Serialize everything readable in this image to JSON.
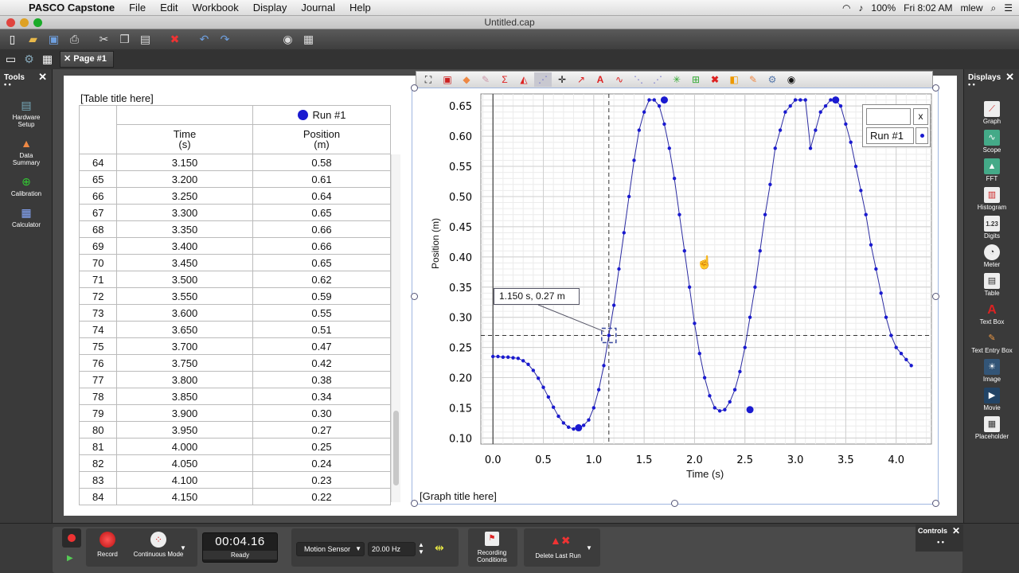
{
  "menubar": {
    "app_name": "PASCO Capstone",
    "items": [
      "File",
      "Edit",
      "Workbook",
      "Display",
      "Journal",
      "Help"
    ],
    "battery": "100%",
    "clock": "Fri 8:02 AM",
    "user": "mlew"
  },
  "window": {
    "title": "Untitled.cap"
  },
  "tabs": {
    "page_label": "Page #1"
  },
  "tools_panel": {
    "title": "Tools",
    "items": [
      {
        "label1": "Hardware",
        "label2": "Setup"
      },
      {
        "label1": "Data",
        "label2": "Summary"
      },
      {
        "label1": "Calibration",
        "label2": ""
      },
      {
        "label1": "Calculator",
        "label2": ""
      }
    ]
  },
  "displays_panel": {
    "title": "Displays",
    "items": [
      "Graph",
      "Scope",
      "FFT",
      "Histogram",
      "Digits",
      "Meter",
      "Table",
      "Text Box",
      "Text Entry Box",
      "Image",
      "Movie",
      "Placeholder"
    ],
    "digits_icon_text": "1.23"
  },
  "table": {
    "title": "[Table title here]",
    "run_label": "Run #1",
    "run_color": "#1a1ad0",
    "col_time": "Time",
    "col_time_unit": "(s)",
    "col_pos": "Position",
    "col_pos_unit": "(m)",
    "rows": [
      [
        "64",
        "3.150",
        "0.58"
      ],
      [
        "65",
        "3.200",
        "0.61"
      ],
      [
        "66",
        "3.250",
        "0.64"
      ],
      [
        "67",
        "3.300",
        "0.65"
      ],
      [
        "68",
        "3.350",
        "0.66"
      ],
      [
        "69",
        "3.400",
        "0.66"
      ],
      [
        "70",
        "3.450",
        "0.65"
      ],
      [
        "71",
        "3.500",
        "0.62"
      ],
      [
        "72",
        "3.550",
        "0.59"
      ],
      [
        "73",
        "3.600",
        "0.55"
      ],
      [
        "74",
        "3.650",
        "0.51"
      ],
      [
        "75",
        "3.700",
        "0.47"
      ],
      [
        "76",
        "3.750",
        "0.42"
      ],
      [
        "77",
        "3.800",
        "0.38"
      ],
      [
        "78",
        "3.850",
        "0.34"
      ],
      [
        "79",
        "3.900",
        "0.30"
      ],
      [
        "80",
        "3.950",
        "0.27"
      ],
      [
        "81",
        "4.000",
        "0.25"
      ],
      [
        "82",
        "4.050",
        "0.24"
      ],
      [
        "83",
        "4.100",
        "0.23"
      ],
      [
        "84",
        "4.150",
        "0.22"
      ]
    ]
  },
  "graph": {
    "title": "[Graph title here]",
    "callout": "1.150 s, 0.27 m",
    "legend_run": "Run #1",
    "legend_close": "x"
  },
  "chart_data": {
    "type": "line",
    "xlabel": "Time (s)",
    "ylabel": "Position (m)",
    "xlim": [
      -0.12,
      4.35
    ],
    "ylim": [
      0.09,
      0.67
    ],
    "xticks": [
      0.0,
      0.5,
      1.0,
      1.5,
      2.0,
      2.5,
      3.0,
      3.5,
      4.0
    ],
    "yticks": [
      0.1,
      0.15,
      0.2,
      0.25,
      0.3,
      0.35,
      0.4,
      0.45,
      0.5,
      0.55,
      0.6,
      0.65
    ],
    "grid": true,
    "legend_position": "top-right",
    "series": [
      {
        "name": "Run #1",
        "color": "#1a1ad0",
        "x": [
          0.0,
          0.05,
          0.1,
          0.15,
          0.2,
          0.25,
          0.3,
          0.35,
          0.4,
          0.45,
          0.5,
          0.55,
          0.6,
          0.65,
          0.7,
          0.75,
          0.8,
          0.85,
          0.9,
          0.95,
          1.0,
          1.05,
          1.1,
          1.15,
          1.2,
          1.25,
          1.3,
          1.35,
          1.4,
          1.45,
          1.5,
          1.55,
          1.6,
          1.65,
          1.7,
          1.75,
          1.8,
          1.85,
          1.9,
          1.95,
          2.0,
          2.05,
          2.1,
          2.15,
          2.2,
          2.25,
          2.3,
          2.35,
          2.4,
          2.45,
          2.5,
          2.55,
          2.6,
          2.65,
          2.7,
          2.75,
          2.8,
          2.85,
          2.9,
          2.95,
          3.0,
          3.05,
          3.1,
          3.15,
          3.2,
          3.25,
          3.3,
          3.35,
          3.4,
          3.45,
          3.5,
          3.55,
          3.6,
          3.65,
          3.7,
          3.75,
          3.8,
          3.85,
          3.9,
          3.95,
          4.0,
          4.05,
          4.1,
          4.15
        ],
        "y": [
          0.235,
          0.235,
          0.234,
          0.234,
          0.233,
          0.232,
          0.228,
          0.222,
          0.212,
          0.199,
          0.184,
          0.168,
          0.151,
          0.136,
          0.125,
          0.118,
          0.115,
          0.117,
          0.121,
          0.13,
          0.15,
          0.18,
          0.22,
          0.27,
          0.32,
          0.38,
          0.44,
          0.5,
          0.56,
          0.61,
          0.64,
          0.66,
          0.66,
          0.65,
          0.62,
          0.58,
          0.53,
          0.47,
          0.41,
          0.35,
          0.29,
          0.24,
          0.2,
          0.17,
          0.15,
          0.145,
          0.147,
          0.16,
          0.18,
          0.21,
          0.25,
          0.3,
          0.35,
          0.41,
          0.47,
          0.52,
          0.58,
          0.61,
          0.64,
          0.65,
          0.66,
          0.66,
          0.66,
          0.58,
          0.61,
          0.64,
          0.65,
          0.66,
          0.66,
          0.65,
          0.62,
          0.59,
          0.55,
          0.51,
          0.47,
          0.42,
          0.38,
          0.34,
          0.3,
          0.27,
          0.25,
          0.24,
          0.23,
          0.22
        ],
        "markers_large": [
          [
            0.85,
            0.117
          ],
          [
            1.7,
            0.66
          ],
          [
            2.55,
            0.147
          ],
          [
            3.4,
            0.66
          ]
        ]
      }
    ],
    "cursor": {
      "x": 1.15,
      "y": 0.27
    }
  },
  "controls": {
    "record": "Record",
    "mode": "Continuous Mode",
    "timer": "00:04.16",
    "status": "Ready",
    "sensor": "Motion Sensor",
    "rate": "20.00 Hz",
    "conditions1": "Recording",
    "conditions2": "Conditions",
    "delete": "Delete Last Run",
    "controls_title": "Controls"
  }
}
